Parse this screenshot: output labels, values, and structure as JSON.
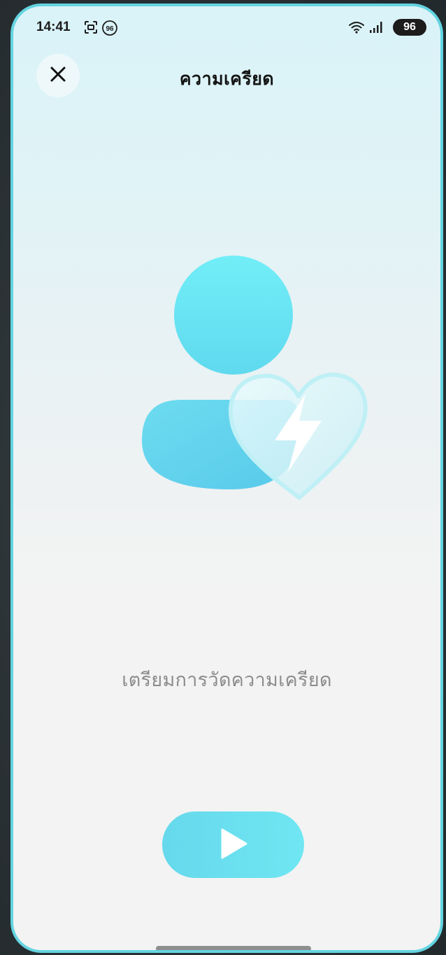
{
  "status_bar": {
    "time": "14:41",
    "battery": "96",
    "notification_badge": "96",
    "icons": [
      "screen-capture-icon",
      "badge-96-icon",
      "wifi-icon",
      "signal-icon"
    ]
  },
  "header": {
    "title": "ความเครียด",
    "close_icon": "close-icon"
  },
  "main": {
    "illustration": "person-heart-lightning-icon",
    "prepare_text": "เตรียมการวัดความเครียด",
    "start_icon": "play-icon"
  },
  "colors": {
    "accent": "#6ee3f1",
    "frame": "#63d4e0",
    "text_secondary": "#8c8c8c"
  }
}
